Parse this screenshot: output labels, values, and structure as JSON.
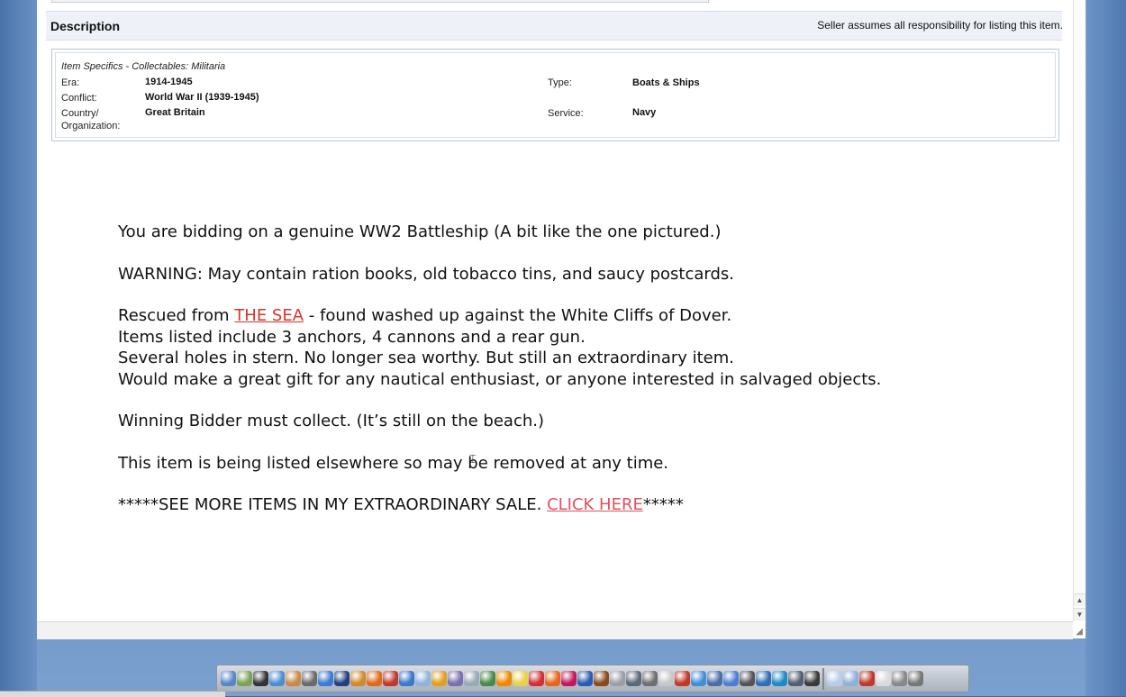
{
  "description_bar": {
    "title": "Description",
    "note": "Seller assumes all responsibility for listing this item."
  },
  "item_specifics": {
    "heading": "Item Specifics - Collectables: Militaria",
    "left": [
      {
        "label": "Era:",
        "value": "1914-1945"
      },
      {
        "label": "Conflict:",
        "value": "World War II (1939-1945)"
      },
      {
        "label": "Country/\nOrganization:",
        "value": "Great Britain"
      }
    ],
    "right": [
      {
        "label": "Type:",
        "value": "Boats & Ships"
      },
      {
        "label": "Service:",
        "value": "Navy"
      }
    ]
  },
  "listing": {
    "line1": "You are bidding on a genuine WW2 Battleship (A bit like the one pictured.)",
    "line2": "WARNING: May contain ration books, old tobacco tins, and saucy postcards.",
    "line3_pre": "Rescued from ",
    "line3_link": "THE SEA",
    "line3_post": " - found washed up against the White Cliffs of Dover.",
    "line4": "Items listed include 3 anchors, 4 cannons and a rear gun.",
    "line5": "Several holes in stern. No longer sea worthy. But still an extraordinary item.",
    "line6": "Would make a great gift for any nautical enthusiast, or anyone interested in salvaged objects.",
    "line7": "Winning Bidder must collect. (It’s still on the beach.)",
    "line8": "This item is being listed elsewhere so may be removed at any time.",
    "line9_pre": "*****SEE MORE ITEMS IN MY EXTRAORDINARY SALE. ",
    "line9_link": "CLICK HERE",
    "line9_post": "*****"
  },
  "dock": {
    "icons": [
      "finder-icon",
      "preview-icon",
      "dvd-icon",
      "itunes-icon",
      "person-icon",
      "news-icon",
      "safari-icon",
      "star-icon",
      "folder-icon",
      "firefox-icon",
      "calendar-icon",
      "mail-icon",
      "music-icon",
      "photo-icon",
      "app-icon",
      "dashboard-icon",
      "game-icon",
      "illustrator-icon",
      "stickies-icon",
      "acrobat-icon",
      "firefox2-icon",
      "indesign-icon",
      "photoshop-icon",
      "bridge-icon",
      "pen-icon",
      "tools-icon",
      "printer-icon",
      "notes-icon",
      "burn-icon",
      "search-icon",
      "network-icon",
      "settings-icon",
      "gear-icon",
      "arrow-icon",
      "globe-icon",
      "disk-icon",
      "terminal-icon",
      "sep",
      "docs-icon",
      "folder2-icon",
      "network2-icon",
      "mail2-icon",
      "camera-icon",
      "trash-icon"
    ],
    "colors": [
      "#5a86c8",
      "#7aa35a",
      "#333333",
      "#4c8ed6",
      "#c98a4b",
      "#6a6a6a",
      "#3b7bd0",
      "#223f80",
      "#d08a2b",
      "#e06a1c",
      "#c0392b",
      "#3a78c8",
      "#8fb3e0",
      "#e0a020",
      "#7a6fb0",
      "#9aa8b8",
      "#4a8a4a",
      "#f08a00",
      "#e8d24a",
      "#d23030",
      "#e8661b",
      "#c2185b",
      "#2a5db0",
      "#8a4b1c",
      "#9aa0a8",
      "#5b6a7a",
      "#707070",
      "#c8c8c8",
      "#c0392b",
      "#3f8fd8",
      "#4a6fa5",
      "#4a7fd0",
      "#555555",
      "#2e6fb5",
      "#1e88c8",
      "#506070",
      "#3a3a3a",
      "",
      "#b8cde8",
      "#8fb0d8",
      "#c0392b",
      "#dadada",
      "#888888",
      "#777777"
    ]
  }
}
